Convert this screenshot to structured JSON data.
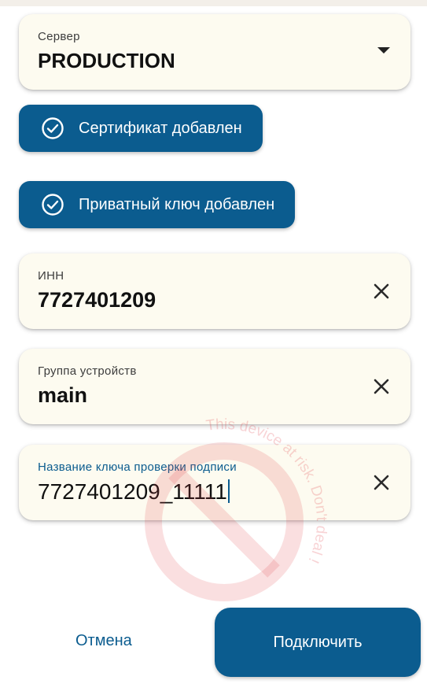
{
  "server": {
    "label": "Сервер",
    "value": "PRODUCTION"
  },
  "chips": {
    "certificate": "Сертификат добавлен",
    "private_key": "Приватный ключ добавлен"
  },
  "fields": {
    "inn": {
      "label": "ИНН",
      "value": "7727401209"
    },
    "device_group": {
      "label": "Группа устройств",
      "value": "main"
    },
    "key_name": {
      "label": "Название ключа проверки подписи",
      "value": "7727401209_11111"
    }
  },
  "watermark": {
    "text": "This device at risk. Don't deal !"
  },
  "actions": {
    "cancel": "Отмена",
    "connect": "Подключить"
  },
  "colors": {
    "accent": "#0b5c8f",
    "card_bg": "#fdfbf0",
    "watermark": "#e0383e"
  }
}
